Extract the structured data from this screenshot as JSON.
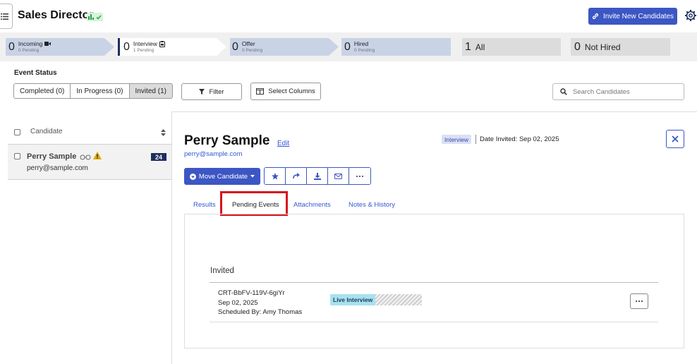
{
  "header": {
    "title": "Sales Director",
    "invite_button": "Invite New Candidates"
  },
  "pipeline": [
    {
      "count": "0",
      "label": "Incoming",
      "sub": "0 Pending",
      "icon": "video-icon",
      "color": "#c9d3e6"
    },
    {
      "count": "0",
      "label": "Interview",
      "sub": "1 Pending",
      "icon": "clipboard-icon",
      "color": "#ffffff"
    },
    {
      "count": "0",
      "label": "Offer",
      "sub": "0 Pending",
      "icon": "",
      "color": "#c9d3e6"
    },
    {
      "count": "0",
      "label": "Hired",
      "sub": "0 Pending",
      "icon": "",
      "color": "#c9d3e6"
    },
    {
      "count": "1",
      "label": "All",
      "sub": "",
      "icon": "",
      "color": "#dcdcdc"
    },
    {
      "count": "0",
      "label": "Not Hired",
      "sub": "",
      "icon": "",
      "color": "#dcdcdc"
    }
  ],
  "event_status": {
    "label": "Event Status",
    "options": [
      "Completed (0)",
      "In Progress (0)",
      "Invited (1)"
    ],
    "selected": "Invited (1)"
  },
  "toolbar": {
    "filter": "Filter",
    "select_columns": "Select Columns",
    "search_placeholder": "Search Candidates"
  },
  "list": {
    "column_header": "Candidate",
    "rows": [
      {
        "name": "Perry Sample",
        "email": "perry@sample.com",
        "score": "24"
      }
    ]
  },
  "detail": {
    "name": "Perry Sample",
    "edit": "Edit",
    "email": "perry@sample.com",
    "stage_badge": "Interview",
    "date_invited": "Date Invited: Sep 02, 2025",
    "move_button": "Move Candidate",
    "tabs": [
      "Results",
      "Pending Events",
      "Attachments",
      "Notes & History"
    ],
    "active_tab": "Pending Events",
    "section_heading": "Invited",
    "event": {
      "id": "CRT-BbFV-119V-6giYr",
      "date": "Sep 02, 2025",
      "scheduled_by": "Scheduled By: Amy Thomas",
      "type": "Live Interview"
    }
  },
  "colors": {
    "primary": "#3c56c4",
    "highlight_box": "#d5121e",
    "live_badge": "#a7e1ef",
    "score_badge": "#1b2f5e"
  }
}
